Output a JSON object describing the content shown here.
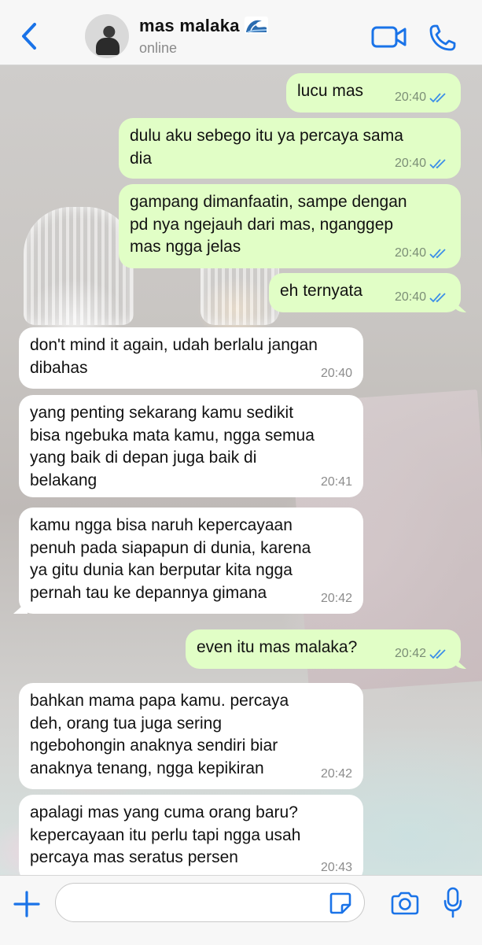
{
  "header": {
    "contact_name": "mas malaka",
    "status": "online",
    "accent": "#1a73e8"
  },
  "messages": [
    {
      "dir": "out",
      "text": "lucu mas",
      "time": "20:40",
      "read": true
    },
    {
      "dir": "out",
      "text": "dulu aku sebego itu ya percaya sama\ndia",
      "time": "20:40",
      "read": true
    },
    {
      "dir": "out",
      "text": "gampang dimanfaatin, sampe dengan\npd nya ngejauh dari mas, nganggep\nmas ngga jelas",
      "time": "20:40",
      "read": true
    },
    {
      "dir": "out",
      "text": "eh ternyata",
      "time": "20:40",
      "read": true
    },
    {
      "dir": "in",
      "text": "don't mind it again, udah berlalu jangan\ndibahas",
      "time": "20:40"
    },
    {
      "dir": "in",
      "text": "yang penting sekarang kamu sedikit\nbisa ngebuka mata kamu, ngga semua\nyang baik di depan juga baik di\nbelakang",
      "time": "20:41"
    },
    {
      "dir": "in",
      "text": "kamu ngga bisa naruh kepercayaan\npenuh pada siapapun di dunia, karena\nya gitu dunia kan berputar kita ngga\npernah tau ke depannya gimana",
      "time": "20:42"
    },
    {
      "dir": "out",
      "text": "even itu mas malaka?",
      "time": "20:42",
      "read": true
    },
    {
      "dir": "in",
      "text": "bahkan mama papa kamu. percaya\ndeh, orang tua juga sering\nngebohongin anaknya sendiri biar\nanaknya tenang, ngga kepikiran",
      "time": "20:42"
    },
    {
      "dir": "in",
      "text": "apalagi mas yang cuma orang baru?\nkepercayaan itu perlu tapi ngga usah\npercaya mas seratus persen",
      "time": "20:43"
    }
  ],
  "input": {
    "value": "",
    "placeholder": ""
  },
  "icons": [
    "back-chevron-icon",
    "wave-emoji-icon",
    "video-call-icon",
    "phone-icon",
    "read-ticks-icon",
    "plus-icon",
    "sticker-icon",
    "camera-icon",
    "microphone-icon"
  ]
}
